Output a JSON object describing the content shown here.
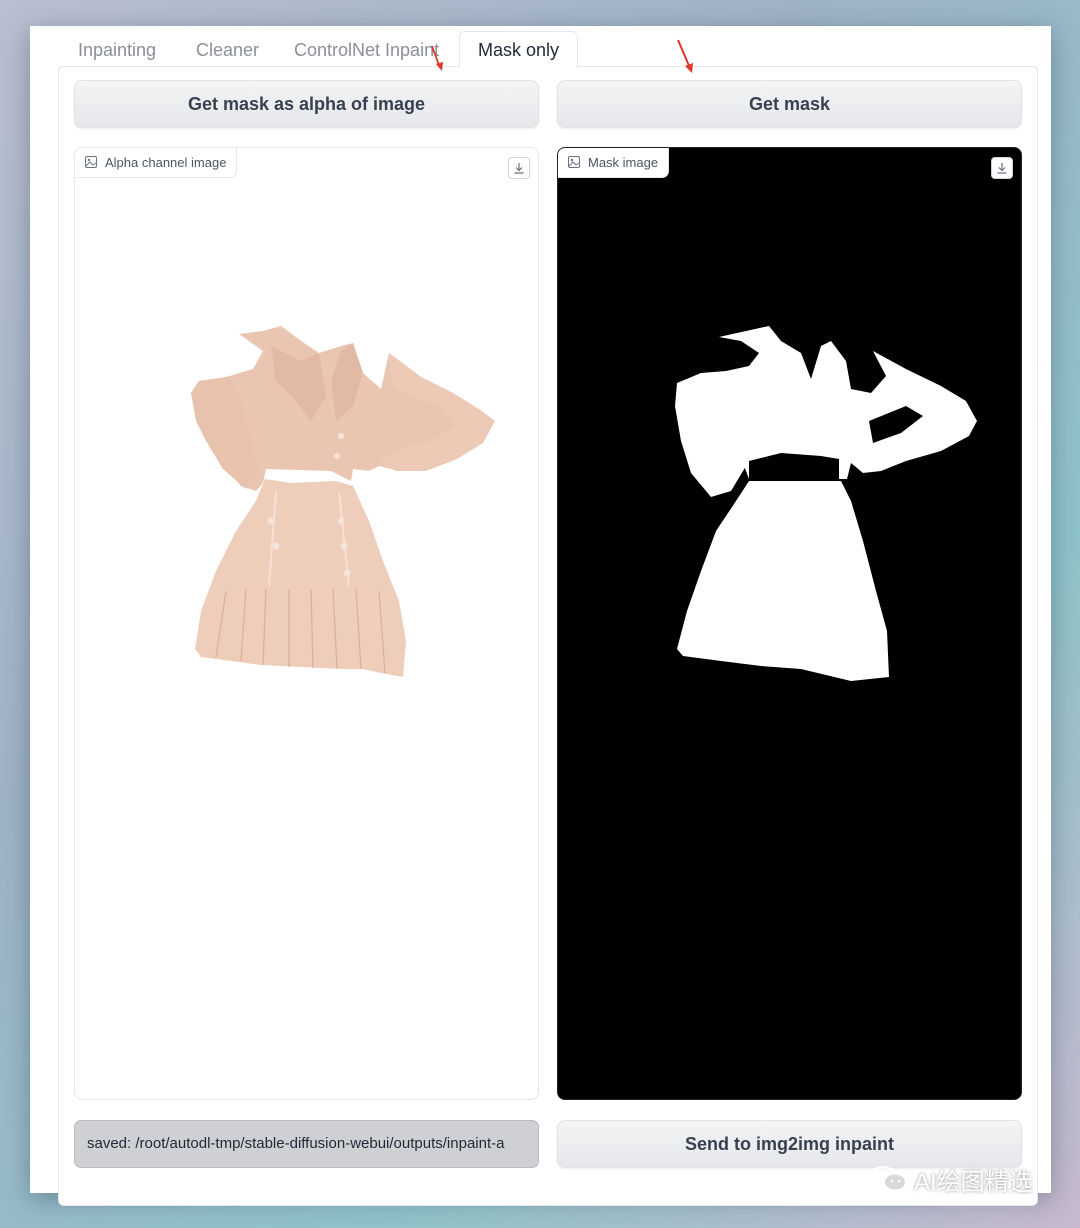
{
  "tabs": [
    {
      "label": "Inpainting",
      "active": false
    },
    {
      "label": "Cleaner",
      "active": false
    },
    {
      "label": "ControlNet Inpaint",
      "active": false
    },
    {
      "label": "Mask only",
      "active": true
    }
  ],
  "buttons": {
    "get_alpha_label": "Get mask as alpha of image",
    "get_mask_label": "Get mask",
    "send_label": "Send to img2img inpaint"
  },
  "alpha_panel": {
    "label": "Alpha channel image",
    "icon": "image-icon",
    "download_icon": "download-icon"
  },
  "mask_panel": {
    "label": "Mask image",
    "icon": "image-icon",
    "download_icon": "download-icon"
  },
  "saved_path": "saved: /root/autodl-tmp/stable-diffusion-webui/outputs/inpaint-a",
  "watermark": "AI绘图精选",
  "colors": {
    "accent_arrow": "#e0342a",
    "mask_bg": "#000000",
    "mask_fg": "#ffffff",
    "garment": "#eecbb8"
  }
}
